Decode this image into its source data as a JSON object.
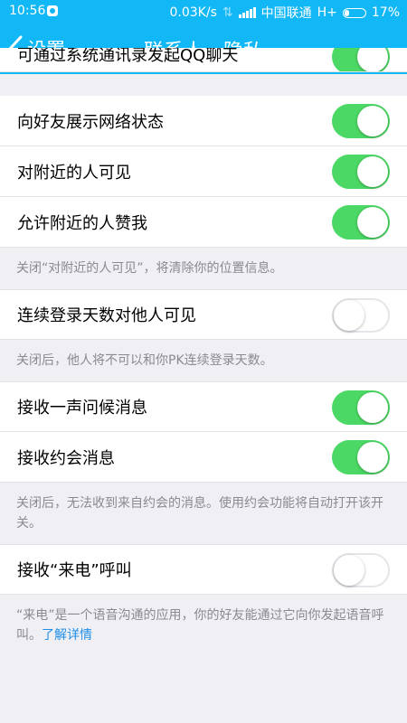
{
  "status": {
    "time": "10:56",
    "speed": "0.03K/s",
    "carrier": "中国联通",
    "network": "H+",
    "battery": "17%"
  },
  "nav": {
    "back_label": "设置",
    "title": "联系人、隐私"
  },
  "rows": {
    "partial": "可通过系统通讯录发起QQ聊天",
    "r1": "向好友展示网络状态",
    "r2": "对附近的人可见",
    "r3": "允许附近的人赞我",
    "r4": "连续登录天数对他人可见",
    "r5": "接收一声问候消息",
    "r6": "接收约会消息",
    "r7": "接收“来电”呼叫"
  },
  "toggles": {
    "partial": true,
    "r1": true,
    "r2": true,
    "r3": true,
    "r4": false,
    "r5": true,
    "r6": true,
    "r7": false
  },
  "notes": {
    "n1": "关闭“对附近的人可见”，将清除你的位置信息。",
    "n2": "关闭后，他人将不可以和你PK连续登录天数。",
    "n3": "关闭后，无法收到来自约会的消息。使用约会功能将自动打开该开关。",
    "n4": "“来电”是一个语音沟通的应用，你的好友能通过它向你发起语音呼叫。",
    "n4_link": "了解详情"
  },
  "colors": {
    "primary": "#12b7f5",
    "toggle_on": "#4cd864",
    "link": "#1f8ee8"
  }
}
